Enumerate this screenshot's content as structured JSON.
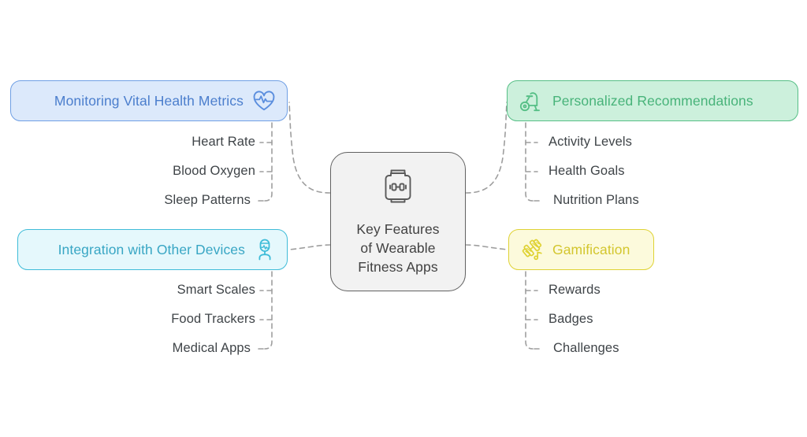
{
  "diagram": {
    "type": "mindmap",
    "title": "Key Features of Wearable Fitness Apps",
    "center": {
      "label": "Key Features\nof Wearable\nFitness Apps",
      "line1": "Key Features",
      "line2": "of Wearable",
      "line3": "Fitness Apps",
      "icon": "smartwatch-dumbbell-icon",
      "fill": "#f2f2f2",
      "border": "#616161",
      "text_color": "#424242"
    },
    "branches": [
      {
        "id": "monitoring",
        "label": "Monitoring Vital Health Metrics",
        "icon": "heart-pulse-icon",
        "side": "left",
        "fill": "#dce9fb",
        "border": "#6f9fe4",
        "text_color": "#4b7ecd",
        "children": [
          "Heart Rate",
          "Blood Oxygen",
          "Sleep Patterns"
        ]
      },
      {
        "id": "integration",
        "label": "Integration with Other Devices",
        "icon": "stethoscope-icon",
        "side": "left",
        "fill": "#e5f8fc",
        "border": "#3fbcd8",
        "text_color": "#38a6c4",
        "children": [
          "Smart Scales",
          "Food Trackers",
          "Medical Apps"
        ]
      },
      {
        "id": "personalized",
        "label": "Personalized Recommendations",
        "icon": "exercise-bike-icon",
        "side": "right",
        "fill": "#ccf0dc",
        "border": "#56bf86",
        "text_color": "#48b37a",
        "children": [
          "Activity Levels",
          "Health Goals",
          "Nutrition Plans"
        ]
      },
      {
        "id": "gamification",
        "label": "Gamification",
        "icon": "dumbbells-icon",
        "side": "right",
        "fill": "#fcfadc",
        "border": "#dfd234",
        "text_color": "#d3c62e",
        "children": [
          "Rewards",
          "Badges",
          "Challenges"
        ]
      }
    ],
    "connector_style": {
      "color": "#9e9e9e",
      "dash": "6 5",
      "width": 1.6
    },
    "background": "#ffffff"
  }
}
